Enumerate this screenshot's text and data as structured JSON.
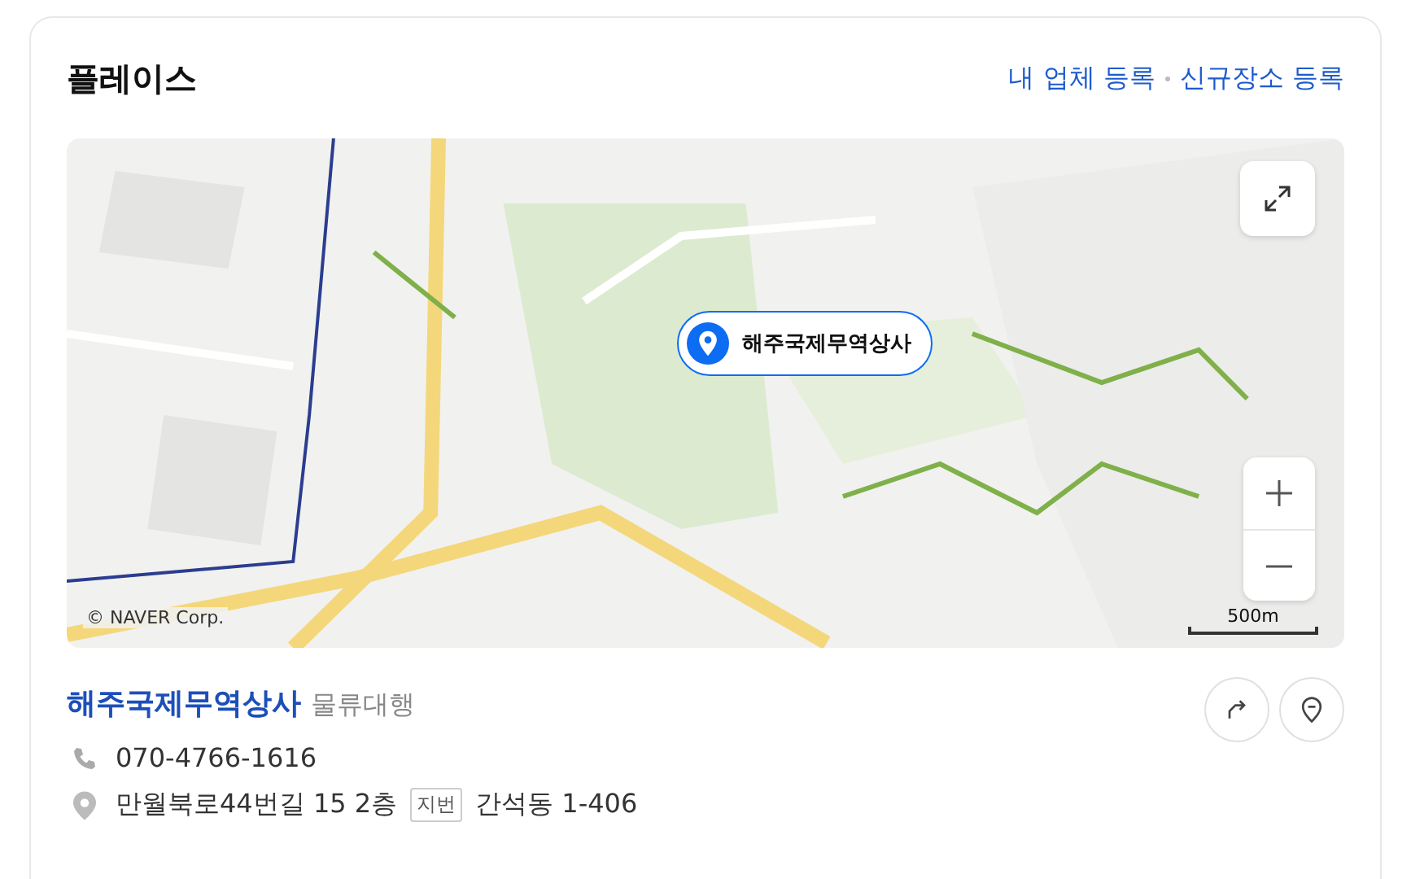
{
  "header": {
    "title": "플레이스",
    "links": [
      "내 업체 등록",
      "신규장소 등록"
    ]
  },
  "map": {
    "kind": "picture",
    "marker": {
      "label": "해주국제무역상사"
    },
    "scale": "500m",
    "copyright": "© NAVER Corp."
  },
  "place": {
    "name": "해주국제무역상사",
    "category": "물류대행",
    "phone": "070-4766-1616",
    "address": "만월북로44번길 15 2층",
    "address_tag": "지번",
    "lot_address": "간석동 1-406"
  }
}
